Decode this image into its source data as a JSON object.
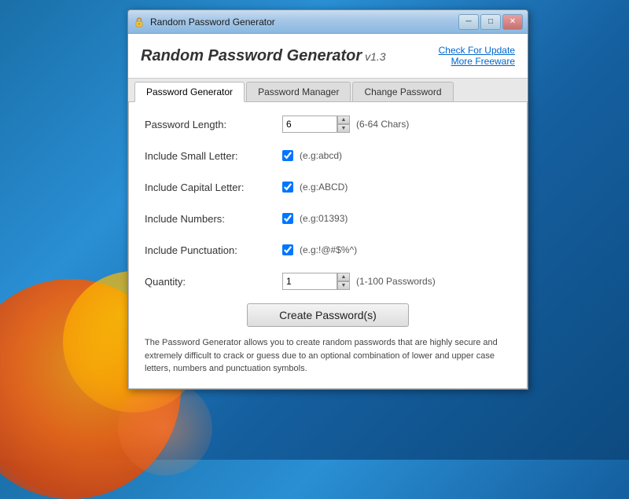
{
  "window": {
    "title": "Random Password Generator",
    "title_icon": "lock",
    "header": {
      "app_name": "Random Password Generator",
      "version": " v1.3",
      "check_update_link": "Check For Update",
      "more_freeware_link": "More Freeware"
    },
    "controls": {
      "minimize": "─",
      "maximize": "□",
      "close": "✕"
    },
    "tabs": [
      {
        "label": "Password Generator",
        "active": true
      },
      {
        "label": "Password Manager",
        "active": false
      },
      {
        "label": "Change Password",
        "active": false
      }
    ],
    "form": {
      "password_length_label": "Password Length:",
      "password_length_value": "6",
      "password_length_hint": "(6-64 Chars)",
      "small_letter_label": "Include Small Letter:",
      "small_letter_checked": true,
      "small_letter_hint": "(e.g:abcd)",
      "capital_letter_label": "Include Capital Letter:",
      "capital_letter_checked": true,
      "capital_letter_hint": "(e.g:ABCD)",
      "numbers_label": "Include Numbers:",
      "numbers_checked": true,
      "numbers_hint": "(e.g:01393)",
      "punctuation_label": "Include Punctuation:",
      "punctuation_checked": true,
      "punctuation_hint": "(e.g:!@#$%^)",
      "quantity_label": "Quantity:",
      "quantity_value": "1",
      "quantity_hint": "(1-100 Passwords)",
      "create_btn_label": "Create Password(s)",
      "description": "The Password Generator allows you to create random passwords that are highly secure and extremely difficult to crack or guess due to an optional combination of lower and upper case letters, numbers and punctuation symbols."
    }
  }
}
